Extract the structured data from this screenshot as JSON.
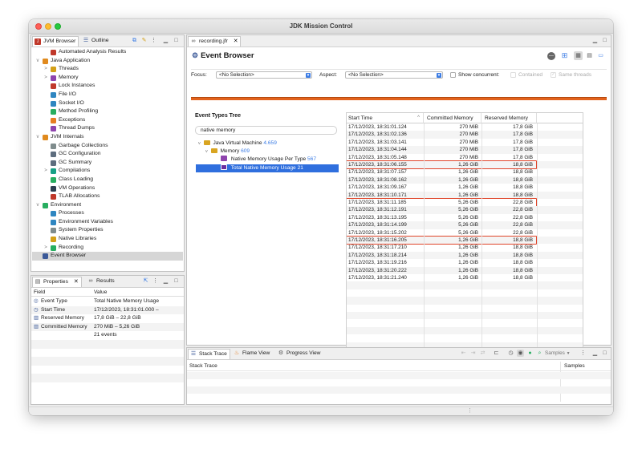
{
  "window": {
    "title": "JDK Mission Control"
  },
  "left_top": {
    "tabs": [
      {
        "label": "JVM Browser"
      },
      {
        "label": "Outline"
      }
    ],
    "tree": [
      {
        "label": "Automated Analysis Results",
        "depth": 2,
        "arrow": "",
        "icon": "report-icon",
        "color": "#c0392b"
      },
      {
        "label": "Java Application",
        "depth": 1,
        "arrow": "v",
        "icon": "java-app-icon",
        "color": "#e08a1e"
      },
      {
        "label": "Threads",
        "depth": 2,
        "arrow": ">",
        "icon": "threads-icon",
        "color": "#d4a017"
      },
      {
        "label": "Memory",
        "depth": 2,
        "arrow": ">",
        "icon": "memory-icon",
        "color": "#8e44ad"
      },
      {
        "label": "Lock Instances",
        "depth": 2,
        "arrow": "",
        "icon": "lock-icon",
        "color": "#c0392b"
      },
      {
        "label": "File I/O",
        "depth": 2,
        "arrow": "",
        "icon": "file-io-icon",
        "color": "#2e86c1"
      },
      {
        "label": "Socket I/O",
        "depth": 2,
        "arrow": "",
        "icon": "socket-io-icon",
        "color": "#2e86c1"
      },
      {
        "label": "Method Profiling",
        "depth": 2,
        "arrow": "",
        "icon": "profiling-icon",
        "color": "#27ae60"
      },
      {
        "label": "Exceptions",
        "depth": 2,
        "arrow": "",
        "icon": "exceptions-icon",
        "color": "#e67e22"
      },
      {
        "label": "Thread Dumps",
        "depth": 2,
        "arrow": "",
        "icon": "thread-dump-icon",
        "color": "#8e44ad"
      },
      {
        "label": "JVM Internals",
        "depth": 1,
        "arrow": "v",
        "icon": "jvm-internals-icon",
        "color": "#e08a1e"
      },
      {
        "label": "Garbage Collections",
        "depth": 2,
        "arrow": "",
        "icon": "gc-icon",
        "color": "#7f8c8d"
      },
      {
        "label": "GC Configuration",
        "depth": 2,
        "arrow": "",
        "icon": "gc-config-icon",
        "color": "#5d6d7e"
      },
      {
        "label": "GC Summary",
        "depth": 2,
        "arrow": "",
        "icon": "gc-summary-icon",
        "color": "#5d6d7e"
      },
      {
        "label": "Compilations",
        "depth": 2,
        "arrow": ">",
        "icon": "compilations-icon",
        "color": "#16a085"
      },
      {
        "label": "Class Loading",
        "depth": 2,
        "arrow": "",
        "icon": "class-loading-icon",
        "color": "#27ae60"
      },
      {
        "label": "VM Operations",
        "depth": 2,
        "arrow": "",
        "icon": "vm-operations-icon",
        "color": "#2c3e50"
      },
      {
        "label": "TLAB Allocations",
        "depth": 2,
        "arrow": "",
        "icon": "tlab-icon",
        "color": "#c0392b"
      },
      {
        "label": "Environment",
        "depth": 1,
        "arrow": "v",
        "icon": "environment-icon",
        "color": "#27ae60"
      },
      {
        "label": "Processes",
        "depth": 2,
        "arrow": "",
        "icon": "processes-icon",
        "color": "#2e86c1"
      },
      {
        "label": "Environment Variables",
        "depth": 2,
        "arrow": "",
        "icon": "env-vars-icon",
        "color": "#2e86c1"
      },
      {
        "label": "System Properties",
        "depth": 2,
        "arrow": "",
        "icon": "system-properties-icon",
        "color": "#7f8c8d"
      },
      {
        "label": "Native Libraries",
        "depth": 2,
        "arrow": "",
        "icon": "native-libraries-icon",
        "color": "#d4a017"
      },
      {
        "label": "Recording",
        "depth": 2,
        "arrow": ">",
        "icon": "recording-icon",
        "color": "#27ae60"
      },
      {
        "label": "Event Browser",
        "depth": 1,
        "arrow": "",
        "icon": "event-browser-icon",
        "color": "#3b5998",
        "selected": true
      }
    ]
  },
  "left_bottom": {
    "tabs": [
      {
        "label": "Properties"
      },
      {
        "label": "Results"
      }
    ],
    "columns": [
      "Field",
      "Value"
    ],
    "rows": [
      {
        "field": "Event Type",
        "value": "Total Native Memory Usage"
      },
      {
        "field": "Start Time",
        "value": "17/12/2023, 18:31:01.000 –"
      },
      {
        "field": "Reserved Memory",
        "value": "17,8 GiB – 22,8 GiB"
      },
      {
        "field": "Committed Memory",
        "value": "270 MiB – 5,26 GiB"
      },
      {
        "field": "",
        "value": "21 events"
      }
    ]
  },
  "editor": {
    "tab_label": "recording.jfr",
    "title": "Event Browser",
    "focus_label": "Focus:",
    "focus_value": "<No Selection>",
    "aspect_label": "Aspect:",
    "aspect_value": "<No Selection>",
    "show_concurrent": "Show concurrent:",
    "contained": "Contained",
    "same_threads": "Same threads",
    "accent": "#e2621c"
  },
  "event_types": {
    "heading": "Event Types Tree",
    "filter": "native memory",
    "nodes": [
      {
        "label": "Java Virtual Machine",
        "count": "4.659"
      },
      {
        "label": "Memory",
        "count": "609"
      },
      {
        "label": "Native Memory Usage Per Type",
        "count": "567"
      },
      {
        "label": "Total Native Memory Usage",
        "count": "21"
      }
    ]
  },
  "table": {
    "columns": [
      "Start Time",
      "Committed Memory",
      "Reserved Memory"
    ],
    "highlight_color": "#e0452a",
    "rows": [
      {
        "time": "17/12/2023, 18:31:01.124",
        "committed": "270 MiB",
        "reserved": "17,8 GiB"
      },
      {
        "time": "17/12/2023, 18:31:02.136",
        "committed": "270 MiB",
        "reserved": "17,8 GiB"
      },
      {
        "time": "17/12/2023, 18:31:03.141",
        "committed": "270 MiB",
        "reserved": "17,8 GiB"
      },
      {
        "time": "17/12/2023, 18:31:04.144",
        "committed": "270 MiB",
        "reserved": "17,8 GiB"
      },
      {
        "time": "17/12/2023, 18:31:05.148",
        "committed": "270 MiB",
        "reserved": "17,8 GiB"
      },
      {
        "time": "17/12/2023, 18:31:06.155",
        "committed": "1,26 GiB",
        "reserved": "18,8 GiB",
        "highlight": true
      },
      {
        "time": "17/12/2023, 18:31:07.157",
        "committed": "1,26 GiB",
        "reserved": "18,8 GiB"
      },
      {
        "time": "17/12/2023, 18:31:08.162",
        "committed": "1,26 GiB",
        "reserved": "18,8 GiB"
      },
      {
        "time": "17/12/2023, 18:31:09.167",
        "committed": "1,26 GiB",
        "reserved": "18,8 GiB"
      },
      {
        "time": "17/12/2023, 18:31:10.171",
        "committed": "1,26 GiB",
        "reserved": "18,8 GiB"
      },
      {
        "time": "17/12/2023, 18:31:11.185",
        "committed": "5,26 GiB",
        "reserved": "22,8 GiB",
        "highlight": true
      },
      {
        "time": "17/12/2023, 18:31:12.191",
        "committed": "5,26 GiB",
        "reserved": "22,8 GiB"
      },
      {
        "time": "17/12/2023, 18:31:13.195",
        "committed": "5,26 GiB",
        "reserved": "22,8 GiB"
      },
      {
        "time": "17/12/2023, 18:31:14.199",
        "committed": "5,26 GiB",
        "reserved": "22,8 GiB"
      },
      {
        "time": "17/12/2023, 18:31:15.202",
        "committed": "5,26 GiB",
        "reserved": "22,8 GiB"
      },
      {
        "time": "17/12/2023, 18:31:16.205",
        "committed": "1,26 GiB",
        "reserved": "18,8 GiB",
        "highlight": true
      },
      {
        "time": "17/12/2023, 18:31:17.210",
        "committed": "1,26 GiB",
        "reserved": "18,8 GiB"
      },
      {
        "time": "17/12/2023, 18:31:18.214",
        "committed": "1,26 GiB",
        "reserved": "18,8 GiB"
      },
      {
        "time": "17/12/2023, 18:31:19.216",
        "committed": "1,26 GiB",
        "reserved": "18,8 GiB"
      },
      {
        "time": "17/12/2023, 18:31:20.222",
        "committed": "1,26 GiB",
        "reserved": "18,8 GiB"
      },
      {
        "time": "17/12/2023, 18:31:21.240",
        "committed": "1,26 GiB",
        "reserved": "18,8 GiB"
      }
    ]
  },
  "bottom": {
    "tabs": [
      {
        "label": "Stack Trace"
      },
      {
        "label": "Flame View"
      },
      {
        "label": "Progress View"
      }
    ],
    "samples_button": "Samples",
    "col_stack": "Stack Trace",
    "col_samples": "Samples"
  }
}
